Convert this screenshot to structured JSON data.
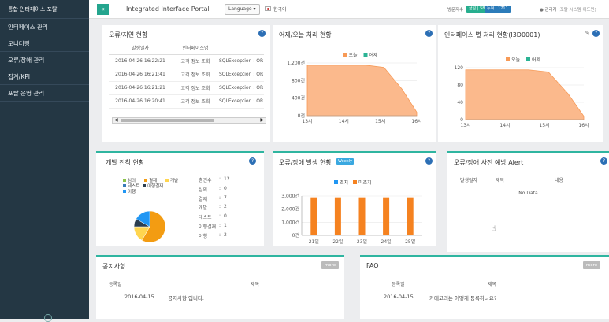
{
  "sidebar": {
    "brand": "통합 인터페이스 포탈",
    "items": [
      "인터페이스 관리",
      "모니터링",
      "오류/장애 관리",
      "집계/KPI",
      "포탈 운영 관리"
    ]
  },
  "header": {
    "toggle": "«",
    "title": "Integrated Interface Portal",
    "language": "Language ▾",
    "korean": "한국어",
    "visitors_label": "방문자수",
    "today_badge": "금일 | 583",
    "total_badge": "누적 | 1711",
    "admin": "관리자",
    "admin_note": "(포탈 시스템 어드민)"
  },
  "err_delay": {
    "title": "오류/지연 현황",
    "col_time": "발생일자",
    "col_if": "인터페이스명",
    "rows": [
      {
        "time": "2016-04-26 16:22:21",
        "name": "고객 정보 조회",
        "msg": "SQLException : OR"
      },
      {
        "time": "2016-04-26 16:21:41",
        "name": "고객 정보 조회",
        "msg": "SQLException : OR"
      },
      {
        "time": "2016-04-26 16:21:21",
        "name": "고객 정보 조회",
        "msg": "SQLException : OR"
      },
      {
        "time": "2016-04-26 16:20:41",
        "name": "고객 정보 조회",
        "msg": "SQLException : OR"
      }
    ]
  },
  "yesterday_today": {
    "title": "어제/오늘 처리 현황"
  },
  "if_status": {
    "title": "인터페이스 별 처리 현황(I3D0001)"
  },
  "dev_status": {
    "title": "개발 진척 현황",
    "legend": [
      "심의",
      "결재",
      "개발",
      "테스트",
      "이행결재",
      "이행"
    ],
    "stats": [
      [
        "총건수",
        "12"
      ],
      [
        "심의",
        "0"
      ],
      [
        "결재",
        "7"
      ],
      [
        "개발",
        "2"
      ],
      [
        "테스트",
        "0"
      ],
      [
        "이행결재",
        "1"
      ],
      [
        "이행",
        "2"
      ]
    ]
  },
  "err_occur": {
    "title": "오류/장애 발생 현황",
    "badge": "Weekly"
  },
  "alert": {
    "title": "오류/장애 사전 예방 Alert",
    "cols": [
      "발생일자",
      "제목",
      "내용"
    ],
    "empty": "No Data"
  },
  "notice": {
    "title": "공지사항",
    "more": "more",
    "col_date": "등록일",
    "col_title": "제목",
    "date": "2016-04-15",
    "text": "공지사항 입니다."
  },
  "faq": {
    "title": "FAQ",
    "more": "more",
    "col_date": "등록일",
    "col_title": "제목",
    "date": "2016-04-15",
    "text": "카테고리는 어떻게 등록하나요?"
  },
  "chart_data": [
    {
      "type": "area",
      "legend_position": "top",
      "series": [
        {
          "name": "오늘",
          "color": "#f79a57"
        },
        {
          "name": "어제",
          "color": "#2bb394"
        }
      ],
      "x": [
        "13시",
        "14시",
        "15시",
        "16시"
      ],
      "yticks": [
        "0건",
        "400건",
        "800건",
        "1,200건"
      ],
      "ylim": [
        0,
        1200
      ],
      "points": [
        [
          0,
          1150
        ],
        [
          1.6,
          1150
        ],
        [
          2.1,
          1100
        ],
        [
          2.6,
          600
        ],
        [
          3,
          80
        ]
      ]
    },
    {
      "type": "area",
      "legend_position": "top",
      "series": [
        {
          "name": "오늘",
          "color": "#f79a57"
        },
        {
          "name": "어제",
          "color": "#2bb394"
        }
      ],
      "x": [
        "13시",
        "14시",
        "15시",
        "16시"
      ],
      "yticks": [
        "0",
        "40",
        "80",
        "120"
      ],
      "ylim": [
        0,
        120
      ],
      "points": [
        [
          0,
          115
        ],
        [
          1.6,
          115
        ],
        [
          2.1,
          110
        ],
        [
          2.6,
          60
        ],
        [
          3,
          8
        ]
      ]
    },
    {
      "type": "pie",
      "labels": [
        "심의",
        "결재",
        "개발",
        "테스트",
        "이행결재",
        "이행"
      ],
      "values": [
        0,
        7,
        2,
        0,
        1,
        2
      ],
      "colors": [
        "#8bc34a",
        "#f39c12",
        "#ffd54f",
        "#3a7bb8",
        "#2c3e50",
        "#2196f3"
      ]
    },
    {
      "type": "bar",
      "legend_position": "top",
      "series": [
        {
          "name": "조치",
          "color": "#2196f3"
        },
        {
          "name": "미조치",
          "color": "#f58220",
          "values": [
            2900,
            2900,
            2900,
            2900,
            2900
          ]
        }
      ],
      "categories": [
        "21일",
        "22일",
        "23일",
        "24일",
        "25일"
      ],
      "yticks": [
        "0건",
        "1,000건",
        "2,000건",
        "3,000건"
      ],
      "ylim": [
        0,
        3000
      ]
    }
  ]
}
